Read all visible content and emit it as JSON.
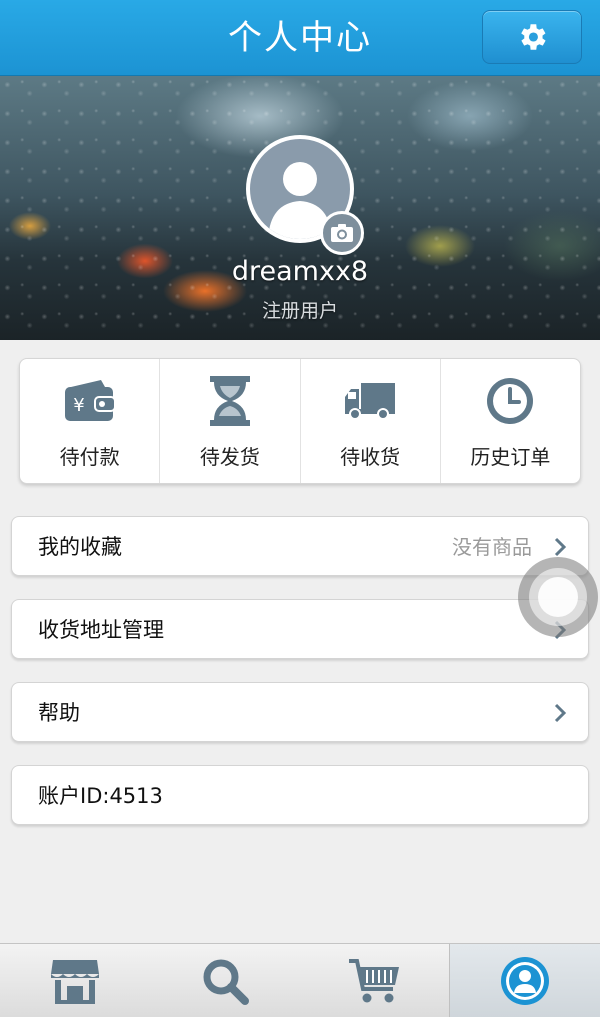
{
  "header": {
    "title": "个人中心",
    "settings_icon": "gear-icon"
  },
  "profile": {
    "username": "dreamxx8",
    "role": "注册用户",
    "avatar_icon": "user-silhouette-icon",
    "camera_icon": "camera-icon"
  },
  "orders": [
    {
      "label": "待付款",
      "icon": "wallet-icon"
    },
    {
      "label": "待发货",
      "icon": "hourglass-icon"
    },
    {
      "label": "待收货",
      "icon": "truck-icon"
    },
    {
      "label": "历史订单",
      "icon": "clock-icon"
    }
  ],
  "menu": {
    "favorites": {
      "label": "我的收藏",
      "value": "没有商品"
    },
    "address": {
      "label": "收货地址管理"
    },
    "help": {
      "label": "帮助"
    },
    "account": {
      "label": "账户ID:4513"
    }
  },
  "tabbar": [
    {
      "icon": "store-icon",
      "active": false
    },
    {
      "icon": "search-icon",
      "active": false
    },
    {
      "icon": "cart-icon",
      "active": false
    },
    {
      "icon": "profile-icon",
      "active": true
    }
  ],
  "colors": {
    "accent": "#1c93d3",
    "icon": "#5f7889"
  }
}
